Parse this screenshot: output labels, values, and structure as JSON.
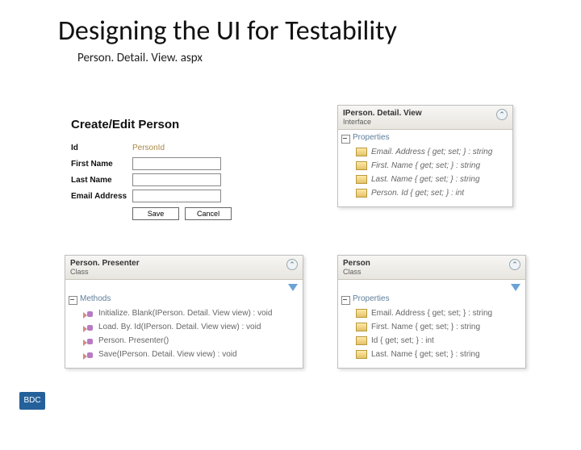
{
  "slide": {
    "title": "Designing the UI for Testability"
  },
  "form": {
    "caption": "Person. Detail. View. aspx",
    "heading": "Create/Edit Person",
    "fields": {
      "id_label": "Id",
      "id_value": "PersonId",
      "first_label": "First Name",
      "last_label": "Last Name",
      "email_label": "Email Address"
    },
    "buttons": {
      "save": "Save",
      "cancel": "Cancel"
    }
  },
  "box_ipdv": {
    "name": "IPerson. Detail. View",
    "stereo": "Interface",
    "section": "Properties",
    "members": [
      "Email. Address { get; set; } : string",
      "First. Name { get; set; } : string",
      "Last. Name { get; set; } : string",
      "Person. Id { get; set; } : int"
    ]
  },
  "box_pp": {
    "name": "Person. Presenter",
    "stereo": "Class",
    "section": "Methods",
    "members": [
      "Initialize. Blank(IPerson. Detail. View view) : void",
      "Load. By. Id(IPerson. Detail. View view) : void",
      "Person. Presenter()",
      "Save(IPerson. Detail. View view) : void"
    ]
  },
  "box_p": {
    "name": "Person",
    "stereo": "Class",
    "section": "Properties",
    "members": [
      "Email. Address { get; set; } : string",
      "First. Name { get; set; } : string",
      "Id { get; set; } : int",
      "Last. Name { get; set; } : string"
    ]
  },
  "slide_number": "BDC"
}
